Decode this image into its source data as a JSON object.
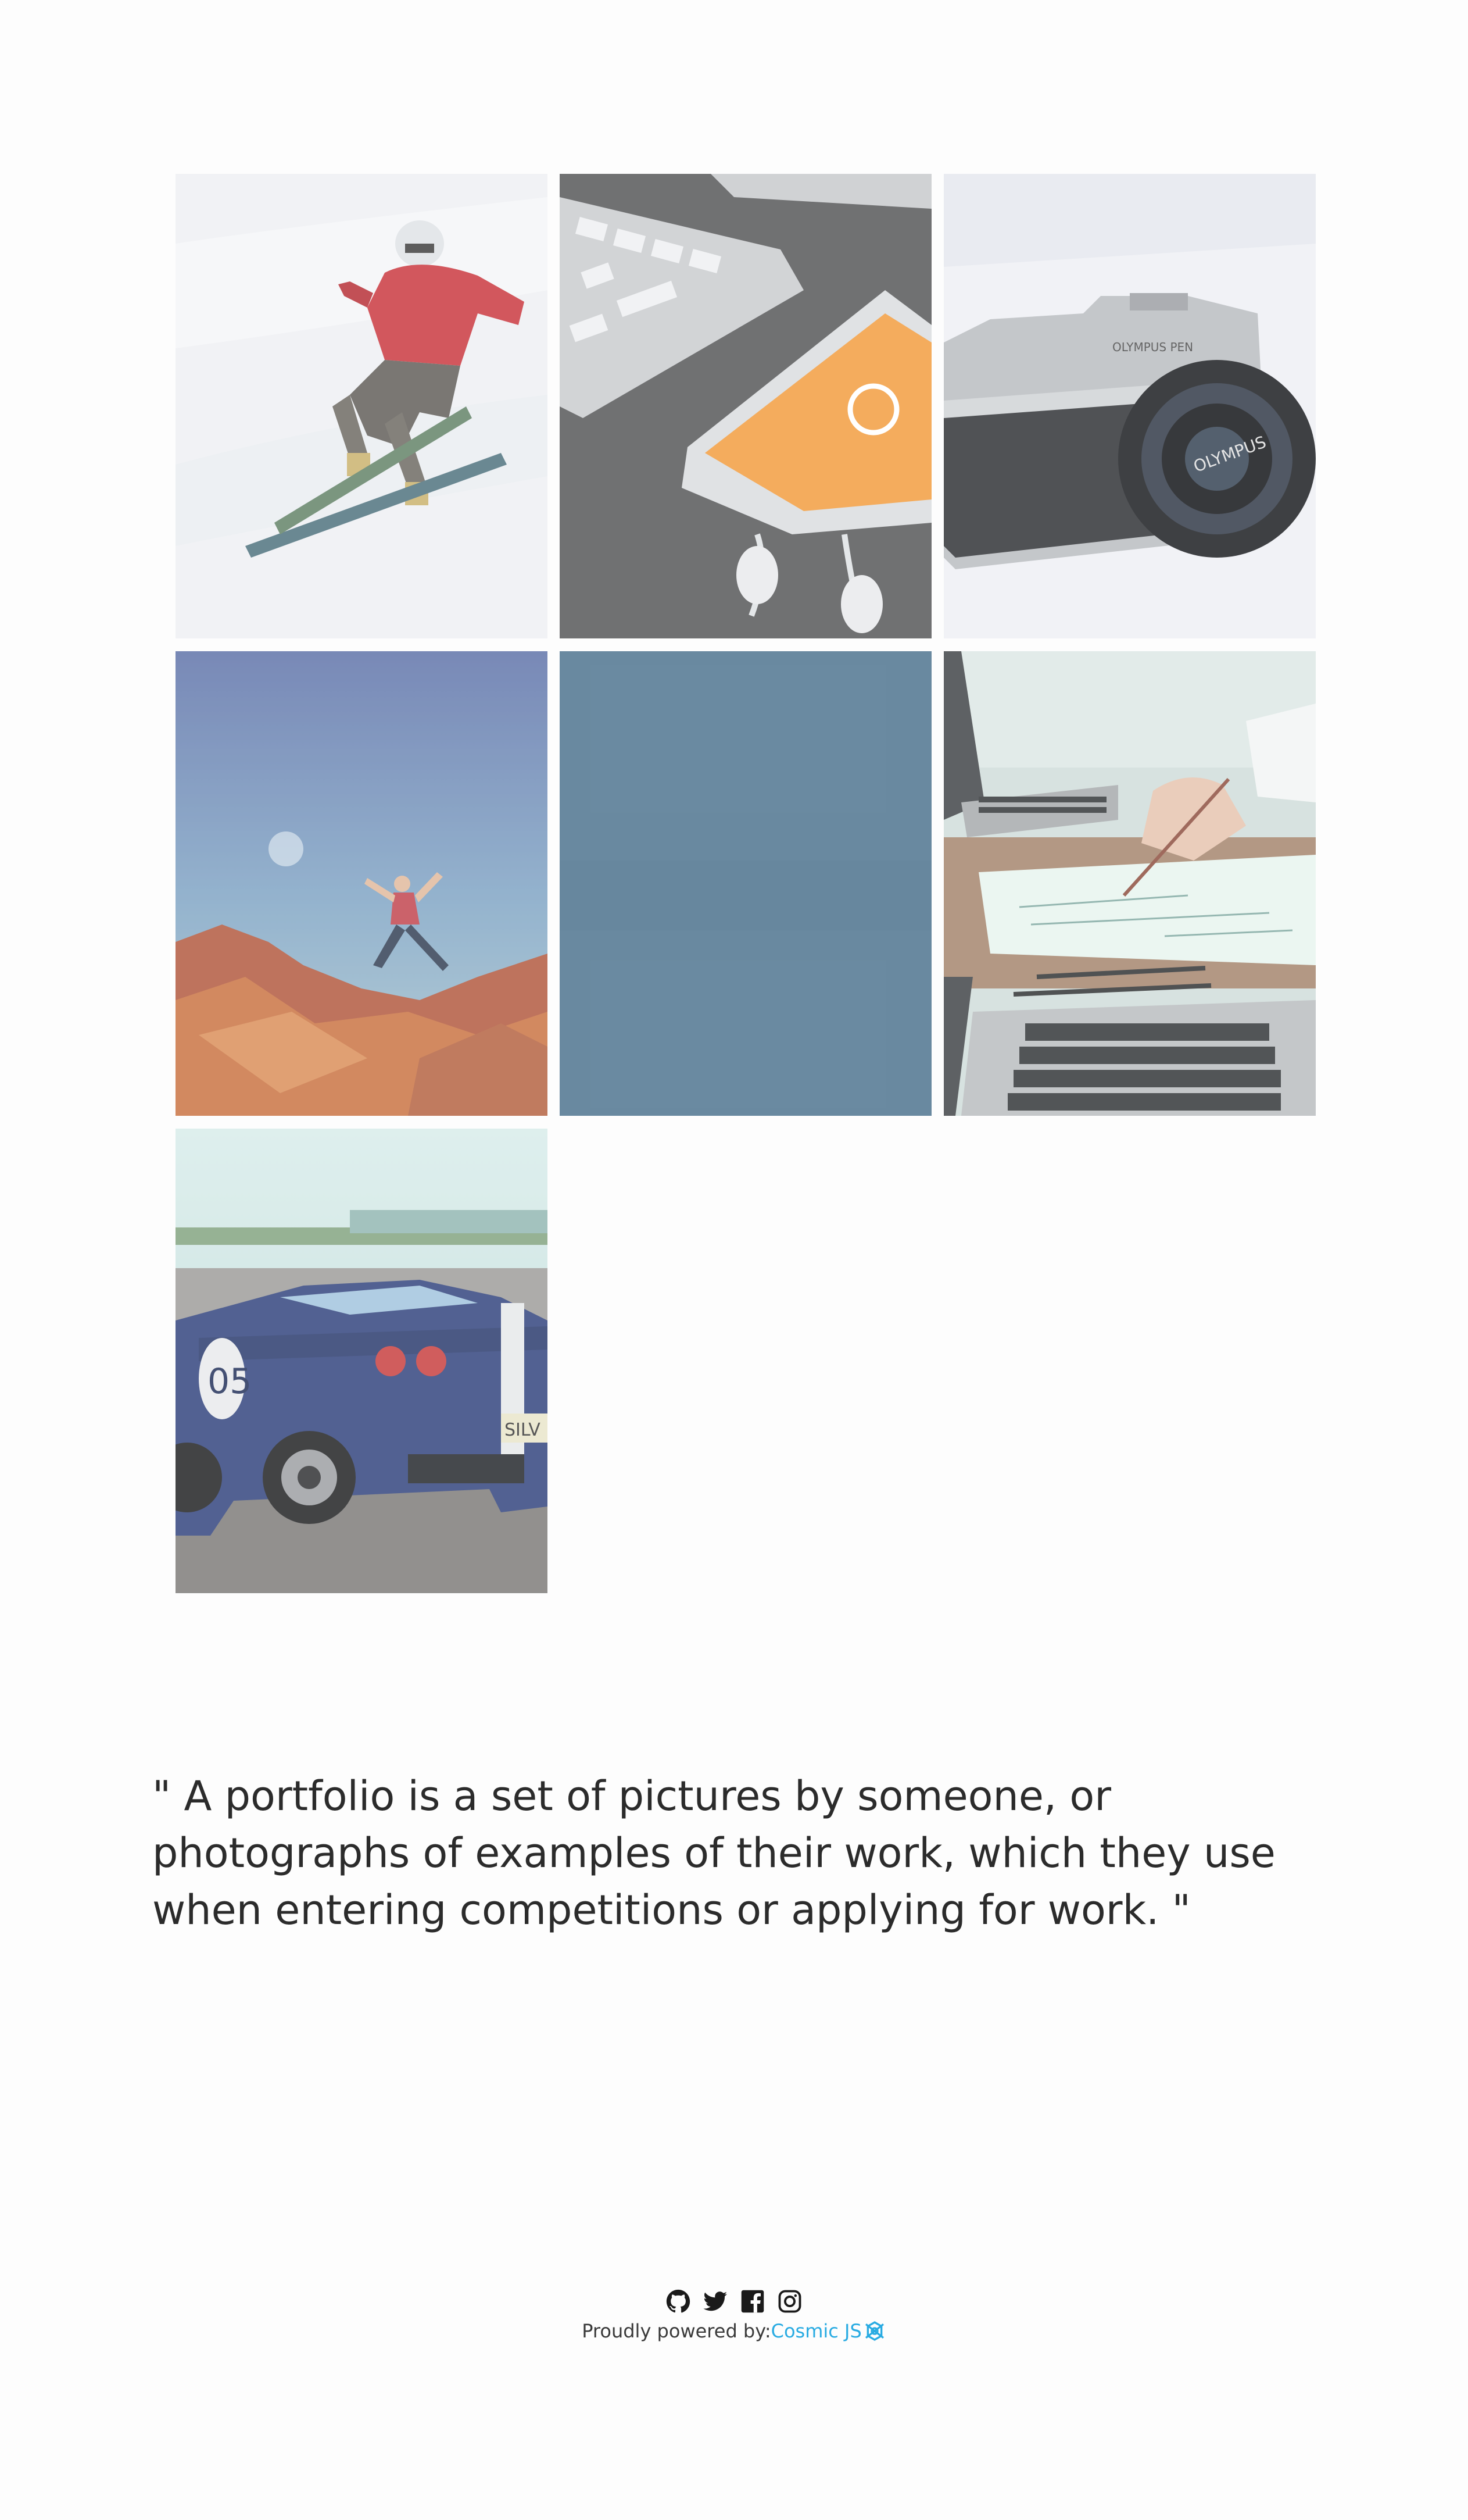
{
  "gallery": {
    "items": [
      {
        "icon": "skier-photo"
      },
      {
        "icon": "phone-keyboard-photo"
      },
      {
        "icon": "camera-photo"
      },
      {
        "icon": "rock-jumper-photo"
      },
      {
        "icon": "blue-blank-photo"
      },
      {
        "icon": "laptop-writing-photo"
      },
      {
        "icon": "sports-car-photo"
      }
    ]
  },
  "quote": {
    "text": "\" A portfolio is a set of pictures by someone, or photographs of examples of their work, which they use when entering competitions or applying for work. \""
  },
  "footer": {
    "social": [
      "github-icon",
      "twitter-icon",
      "facebook-icon",
      "instagram-icon"
    ],
    "powered_label": "Proudly powered by:",
    "brand_label": "Cosmic JS",
    "brand_color": "#29abe2"
  },
  "colors": {
    "background": "#fdfdfd",
    "text": "#2b2b2b",
    "accent": "#29abe2"
  }
}
